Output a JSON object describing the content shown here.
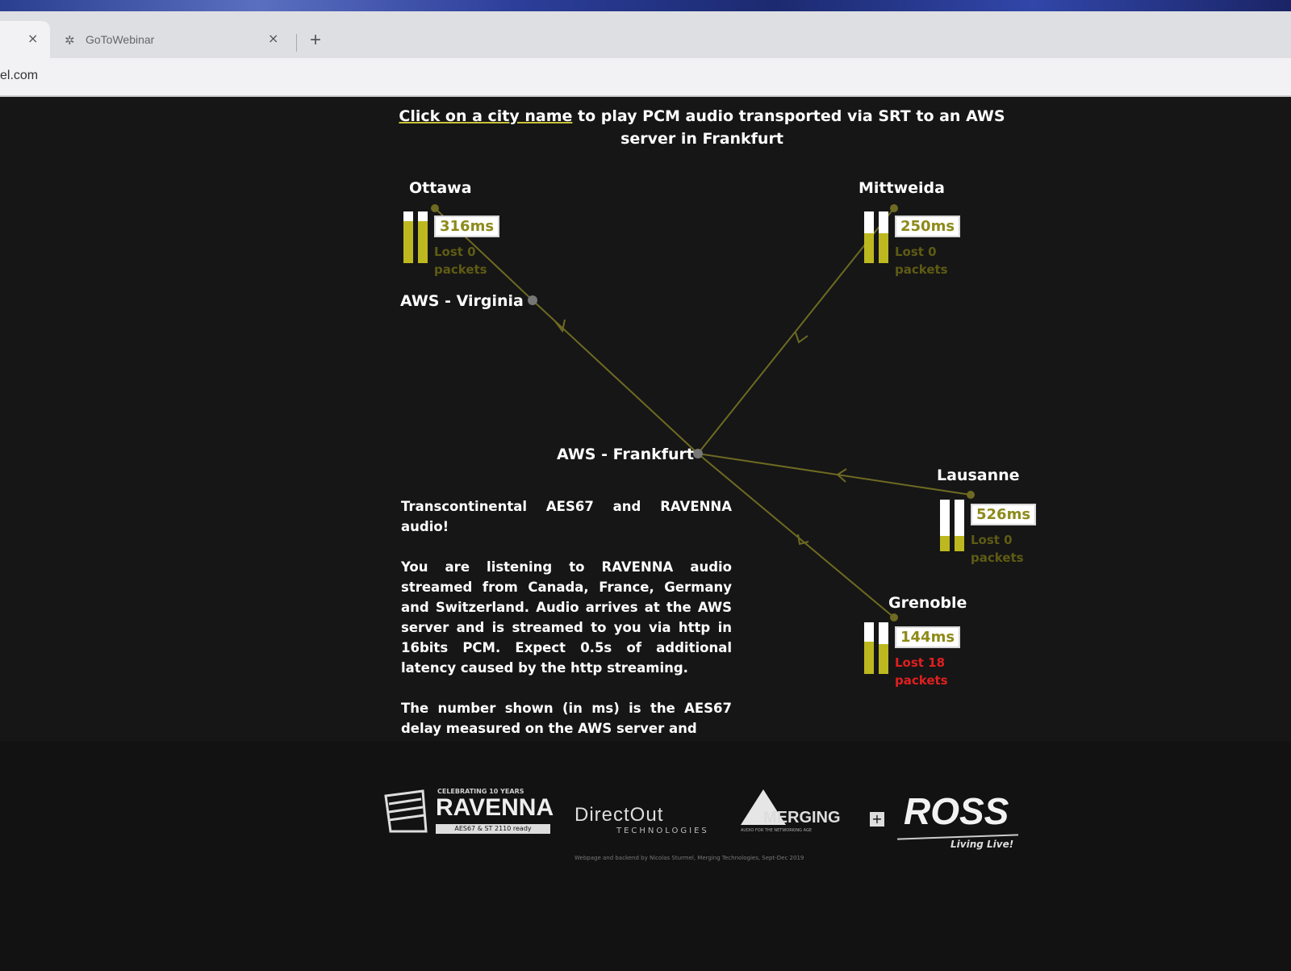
{
  "browser": {
    "tabs": [
      {
        "title": "",
        "active": true
      },
      {
        "title": "GoToWebinar",
        "active": false
      }
    ],
    "new_tab_icon": "+",
    "close_icon": "×",
    "url_fragment": "el.com"
  },
  "page": {
    "headline_link": "Click on a city name",
    "headline_rest": " to play PCM audio transported via SRT to an AWS server in Frankfurt",
    "aws_nodes": [
      "AWS - Virginia",
      "AWS - Frankfurt"
    ],
    "cities": [
      {
        "name": "Ottawa",
        "delay": "316ms",
        "lost": "Lost 0 packets",
        "level_l": 0.82,
        "level_r": 0.82,
        "status": "ok"
      },
      {
        "name": "Mittweida",
        "delay": "250ms",
        "lost": "Lost 0 packets",
        "level_l": 0.58,
        "level_r": 0.58,
        "status": "ok"
      },
      {
        "name": "Lausanne",
        "delay": "526ms",
        "lost": "Lost 0 packets",
        "level_l": 0.3,
        "level_r": 0.3,
        "status": "ok"
      },
      {
        "name": "Grenoble",
        "delay": "144ms",
        "lost": "Lost 18 packets",
        "level_l": 0.62,
        "level_r": 0.58,
        "status": "error"
      }
    ],
    "description": [
      "Transcontinental AES67 and RAVENNA audio!",
      "You are listening to RAVENNA audio streamed from Canada, France, Germany and Switzerland. Audio arrives at the AWS server and is streamed to you via http in 16bits PCM. Expect 0.5s of additional latency caused by the http streaming.",
      "The number shown (in ms) is the AES67 delay measured on the AWS server and"
    ]
  },
  "footer": {
    "logos": [
      {
        "name": "RAVENNA",
        "tagline": "CELEBRATING 10 YEARS",
        "sub": "AES67 & ST 2110 ready"
      },
      {
        "name": "DirectOut",
        "sub": "TECHNOLOGIES"
      },
      {
        "name": "MERGING",
        "sub": "AUDIO FOR THE NETWORKING AGE"
      },
      {
        "name": "ROSS",
        "sub": "Living Live!"
      }
    ],
    "credit": "Webpage and backend by Nicolas Sturmel, Merging Technologies, Sept-Dec 2019"
  },
  "colors": {
    "accent": "#bdb81f",
    "link_line": "#6e6a22",
    "error": "#e01f1f"
  }
}
